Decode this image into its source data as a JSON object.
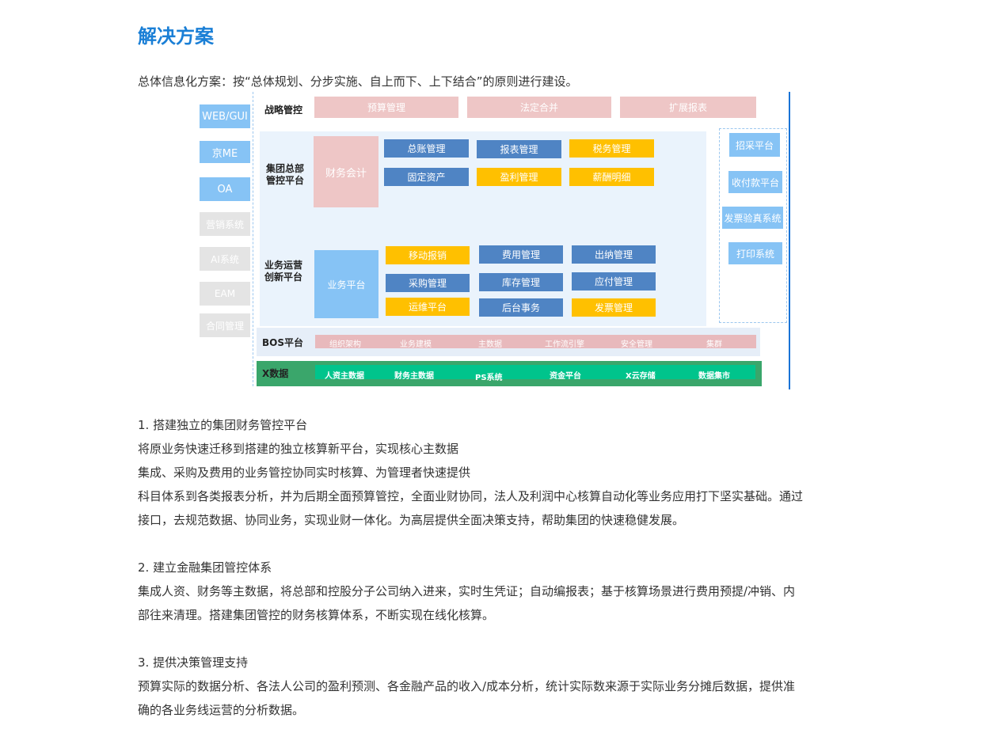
{
  "title": "解决方案",
  "intro": "总体信息化方案：按“总体规划、分步实施、自上而下、上下结合”的原则进行建设。",
  "diagram": {
    "left_items": [
      "WEB/GUI",
      "京ME",
      "OA",
      "营销系统",
      "AI系统",
      "EAM",
      "合同管理"
    ],
    "strategy": {
      "label": "战略管控",
      "items": [
        "预算管理",
        "法定合并",
        "扩展报表"
      ]
    },
    "group": {
      "label_line1": "集团总部",
      "label_line2": "管控平台",
      "main": "财务会计",
      "items": [
        "总账管理",
        "报表管理",
        "税务管理",
        "固定资产",
        "盈利管理",
        "薪酬明细"
      ]
    },
    "ops": {
      "label_line1": "业务运营",
      "label_line2": "创新平台",
      "main": "业务平台",
      "items": [
        "移动报销",
        "费用管理",
        "出纳管理",
        "采购管理",
        "库存管理",
        "应付管理",
        "运维平台",
        "后台事务",
        "发票管理"
      ]
    },
    "right_items": [
      "招采平台",
      "收付款平台",
      "发票验真系统",
      "打印系统"
    ],
    "bos": {
      "label": "BOS平台",
      "items": [
        "组织架构",
        "业务建模",
        "主数据",
        "工作流引擎",
        "安全管理",
        "集群"
      ]
    },
    "x": {
      "label": "X数据",
      "items": [
        "人资主数据",
        "财务主数据",
        "PS系统",
        "资金平台",
        "X云存储",
        "数据集市"
      ]
    }
  },
  "sections": [
    {
      "heading": "1. 搭建独立的集团财务管控平台",
      "lines": [
        "将原业务快速迁移到搭建的独立核算新平台，实现核心主数据",
        "集成、采购及费用的业务管控协同实时核算、为管理者快速提供",
        "科目体系到各类报表分析，并为后期全面预算管控，全面业财协同，法人及利润中心核算自动化等业务应用打下坚实基础。通过",
        "接口，去规范数据、协同业务，实现业财一体化。为高层提供全面决策支持，帮助集团的快速稳健发展。"
      ]
    },
    {
      "heading": "2. 建立金融集团管控体系",
      "lines": [
        "集成人资、财务等主数据，将总部和控股分子公司纳入进来，实时生凭证；自动编报表；基于核算场景进行费用预提/冲销、内",
        "部往来清理。搭建集团管控的财务核算体系，不断实现在线化核算。"
      ]
    },
    {
      "heading": "3. 提供决策管理支持",
      "lines": [
        "预算实际的数据分析、各法人公司的盈利预测、各金融产品的收入/成本分析，统计实际数来源于实际业务分摊后数据，提供准",
        "确的各业务线运营的分析数据。"
      ]
    }
  ]
}
